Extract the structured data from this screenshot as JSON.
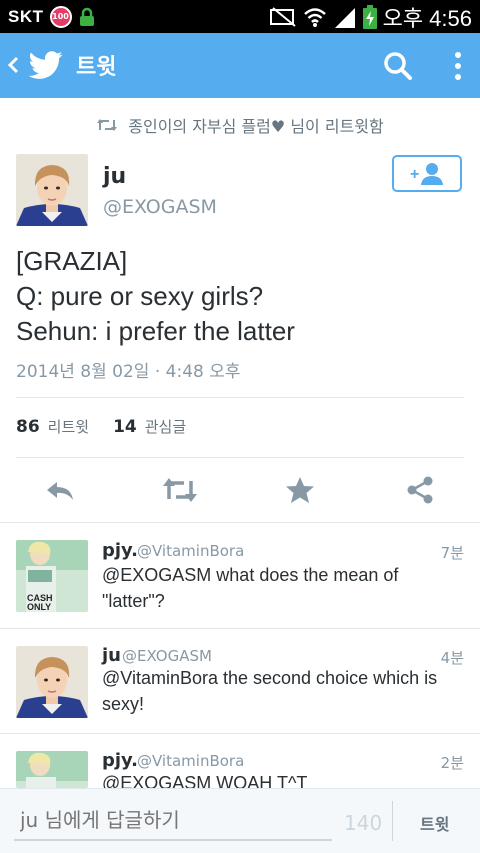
{
  "status_bar": {
    "carrier": "SKT",
    "badge": "100",
    "time": "오후 4:56"
  },
  "action_bar": {
    "title": "트윗"
  },
  "retweet_line": {
    "text": "종인이의 자부심 플럼♥ 님이 리트윗함"
  },
  "main_tweet": {
    "name": "ju",
    "handle": "@EXOGASM",
    "text_lines": [
      "[GRAZIA]",
      "Q: pure or sexy girls?",
      "Sehun: i prefer the latter"
    ],
    "date": "2014년 8월 02일 · 4:48 오후",
    "retweet_count": "86",
    "retweet_label": "리트윗",
    "favorite_count": "14",
    "favorite_label": "관심글"
  },
  "replies": [
    {
      "name": "pjy.",
      "handle": "@VitaminBora",
      "time": "7분",
      "text": "@EXOGASM what does the mean of \"latter\"?"
    },
    {
      "name": "ju",
      "handle": "@EXOGASM",
      "time": "4분",
      "text": "@VitaminBora the second choice which is sexy!"
    },
    {
      "name": "pjy.",
      "handle": "@VitaminBora",
      "time": "2분",
      "text": "@EXOGASM WOAH T^T"
    }
  ],
  "compose": {
    "placeholder": "ju 님에게 답글하기",
    "char_count": "140",
    "button_label": "트윗"
  },
  "colors": {
    "accent": "#55acee",
    "status_bar": "#000000",
    "text_primary": "#292f33",
    "text_secondary": "#8899a6"
  },
  "icons": {
    "back": "chevron-left-icon",
    "logo": "twitter-bird-icon",
    "search": "search-icon",
    "more": "more-vert-icon",
    "retweet": "retweet-icon",
    "follow": "add-user-icon",
    "reply": "reply-icon",
    "favorite": "star-icon",
    "share": "share-icon"
  }
}
